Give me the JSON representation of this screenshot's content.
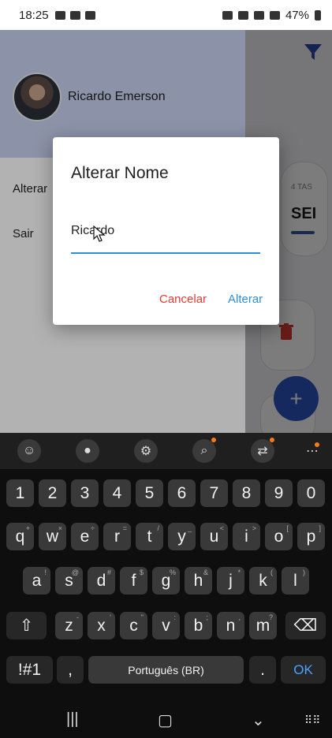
{
  "status_bar": {
    "time": "18:25",
    "battery": "47%"
  },
  "drawer": {
    "user_name": "Ricardo Emerson",
    "items": [
      {
        "label": "Alterar"
      },
      {
        "label": "Sair"
      }
    ]
  },
  "main": {
    "task_count": "4 TAS",
    "task_label": "SEI"
  },
  "dialog": {
    "title": "Alterar Nome",
    "input_value": "Ricardo",
    "cancel_label": "Cancelar",
    "confirm_label": "Alterar"
  },
  "keyboard": {
    "rows": [
      [
        "1",
        "2",
        "3",
        "4",
        "5",
        "6",
        "7",
        "8",
        "9",
        "0"
      ],
      [
        "q",
        "w",
        "e",
        "r",
        "t",
        "y",
        "u",
        "i",
        "o",
        "p"
      ],
      [
        "a",
        "s",
        "d",
        "f",
        "g",
        "h",
        "j",
        "k",
        "l"
      ],
      [
        "z",
        "x",
        "c",
        "v",
        "b",
        "n",
        "m"
      ]
    ],
    "hints": {
      "q": "+",
      "w": "×",
      "e": "÷",
      "r": "=",
      "t": "/",
      "y": "_",
      "u": "<",
      "i": ">",
      "o": "[",
      "p": "]",
      "a": "!",
      "s": "@",
      "d": "#",
      "f": "$",
      "g": "%",
      "h": "&",
      "j": "*",
      "k": "(",
      "l": ")",
      "z": "-",
      "x": "'",
      "c": "\"",
      "v": ":",
      "b": ";",
      "n": ",",
      "m": "?"
    },
    "symbols_label": "!#1",
    "comma_label": ",",
    "space_label": "Português (BR)",
    "period_label": ".",
    "ok_label": "OK"
  },
  "colors": {
    "accent_blue": "#2e8fd6",
    "cancel_red": "#e23b36",
    "fab_blue": "#2f55c5"
  }
}
